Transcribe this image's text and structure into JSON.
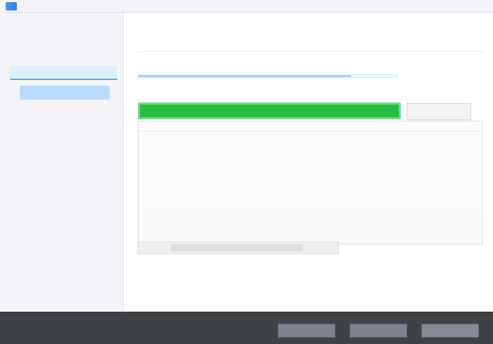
{
  "window": {
    "title": ""
  },
  "sidebar": {
    "header": "",
    "subheader": "",
    "items": [
      {
        "label": "",
        "active": false
      },
      {
        "label": "",
        "active": true
      },
      {
        "label": "",
        "selected": true
      },
      {
        "label": ""
      },
      {
        "label": ""
      },
      {
        "label": ""
      },
      {
        "label": ""
      }
    ]
  },
  "main": {
    "title": "",
    "description": "",
    "section_label": "",
    "progress_percent": 82,
    "green_tab_label": "",
    "tab_button_label": ""
  },
  "table": {
    "columns": [
      "",
      "",
      "",
      ""
    ],
    "rows": []
  },
  "progress_strip": {
    "label": ""
  },
  "footer": {
    "link": ""
  },
  "bottom_buttons": [
    {
      "label": ""
    },
    {
      "label": ""
    },
    {
      "label": ""
    }
  ],
  "colors": {
    "accent": "#26bd42",
    "selection": "#b9dcff",
    "footer": "#3f4247"
  }
}
